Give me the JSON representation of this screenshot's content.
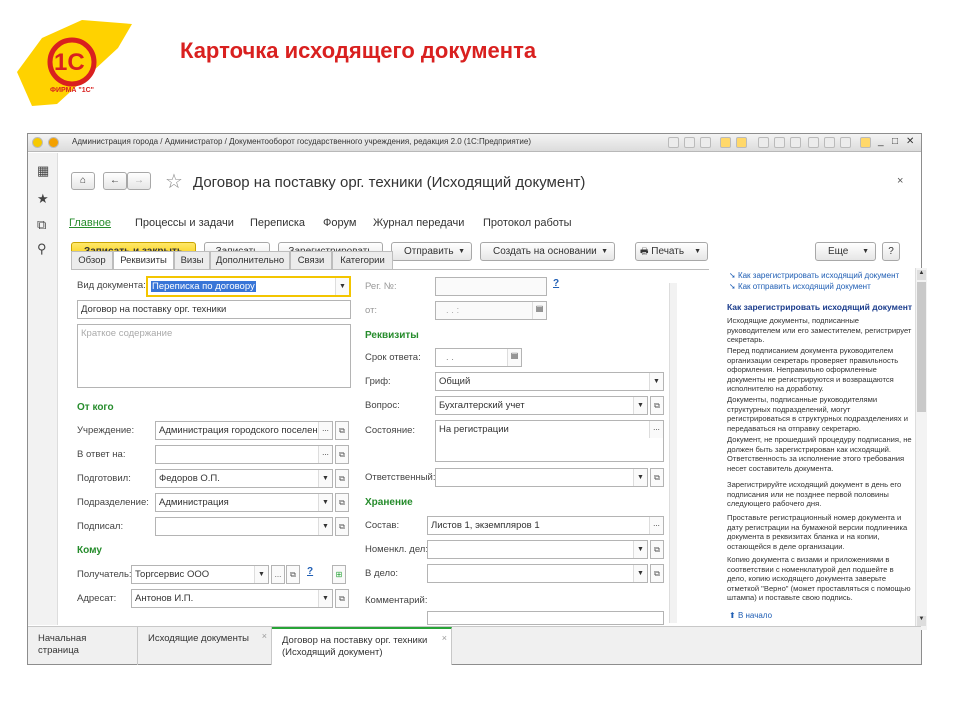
{
  "slide": {
    "title": "Карточка исходящего документа",
    "logo_text": "1С",
    "logo_sub": "ФИРМА \"1С\""
  },
  "window": {
    "title": "Администрация города / Администратор / Документооборот государственного учреждения, редакция 2.0  (1С:Предприятие)"
  },
  "document": {
    "title": "Договор на поставку орг. техники (Исходящий документ)"
  },
  "nav": [
    "Главное",
    "Процессы и задачи",
    "Переписка",
    "Форум",
    "Журнал передачи",
    "Протокол работы"
  ],
  "toolbar": {
    "save_close": "Записать и закрыть",
    "save": "Записать",
    "register": "Зарегистрировать",
    "send": "Отправить",
    "create_based": "Создать на основании",
    "print": "Печать",
    "more": "Еще",
    "help": "?"
  },
  "tabs": [
    "Обзор",
    "Реквизиты",
    "Визы",
    "Дополнительно",
    "Связи",
    "Категории"
  ],
  "form": {
    "doc_type_label": "Вид документа:",
    "doc_type_value": "Переписка по договору",
    "subject_value": "Договор на поставку орг. техники",
    "summary_placeholder": "Краткое содержание",
    "from_section": "От кого",
    "institution_label": "Учреждение:",
    "institution_value": "Администрация городского поселения",
    "reply_to_label": "В ответ на:",
    "prepared_label": "Подготовил:",
    "prepared_value": "Федоров О.П.",
    "department_label": "Подразделение:",
    "department_value": "Администрация",
    "signed_label": "Подписал:",
    "to_section": "Кому",
    "recipient_label": "Получатель:",
    "recipient_value": "Торгсервис ООО",
    "addressee_label": "Адресат:",
    "addressee_value": "Антонов И.П.",
    "reg_no_label": "Рег. №:",
    "from_date_label": "от:",
    "from_date_value": ". .     :",
    "requisites_section": "Реквизиты",
    "deadline_label": "Срок ответа:",
    "deadline_value": ". .",
    "grif_label": "Гриф:",
    "grif_value": "Общий",
    "question_label": "Вопрос:",
    "question_value": "Бухгалтерский учет",
    "state_label": "Состояние:",
    "state_value": "На регистрации",
    "responsible_label": "Ответственный:",
    "storage_section": "Хранение",
    "composition_label": "Состав:",
    "composition_value": "Листов 1, экземпляров 1",
    "nomencl_label": "Номенкл. дел:",
    "to_case_label": "В дело:",
    "comment_label": "Комментарий:"
  },
  "help": {
    "links": [
      "Как зарегистрировать исходящий документ",
      "Как отправить исходящий документ"
    ],
    "title": "Как зарегистрировать исходящий документ",
    "paragraphs": [
      "Исходящие документы, подписанные руководителем или его заместителем, регистрирует секретарь.",
      "Перед подписанием документа руководителем организации секретарь проверяет правильность оформления. Неправильно оформленные документы не регистрируются и возвращаются исполнителю на доработку.",
      "Документы, подписанные руководителями структурных подразделений, могут регистрироваться в структурных подразделениях и передаваться на отправку секретарю.",
      "Документ, не прошедший процедуру подписания, не должен быть зарегистрирован как исходящий. Ответственность за исполнение этого требования несет составитель документа.",
      "Зарегистрируйте исходящий документ в день его подписания или не позднее первой половины следующего рабочего дня.",
      "Проставьте регистрационный номер документа и дату регистрации на бумажной версии подлинника документа в реквизитах бланка и на копии, остающейся в деле организации.",
      "Копию документа с визами и приложениями в соответствии с номенклатурой дел подшейте в дело, копию исходящего документа заверьте отметкой \"Верно\" (может проставляться с помощью штампа) и поставьте свою подпись."
    ],
    "back_link": "В начало"
  },
  "taskbar": [
    "Начальная страница",
    "Исходящие документы",
    "Договор на поставку орг. техники (Исходящий документ)"
  ]
}
